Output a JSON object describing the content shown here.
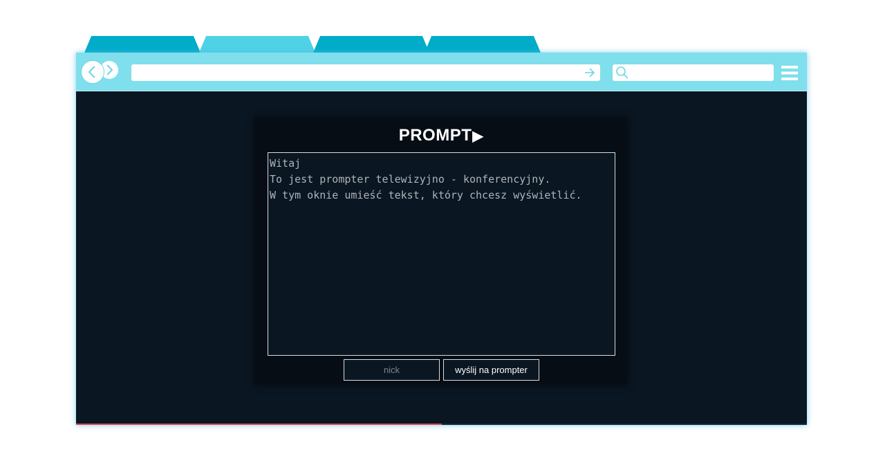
{
  "colors": {
    "tab": "#00acc8",
    "tab_active": "#4fd2e6",
    "toolbar": "#80dfec",
    "viewport_bg": "#0a1622",
    "panel_bg": "#060d15",
    "progress_fill": "#e4494d"
  },
  "browser": {
    "tabs": [
      {
        "active": false
      },
      {
        "active": true
      },
      {
        "active": false
      },
      {
        "active": false
      }
    ],
    "icons": {
      "back": "chevron-left-icon",
      "forward": "chevron-right-icon",
      "go": "arrow-right-icon",
      "search": "search-icon",
      "menu": "hamburger-menu-icon"
    },
    "url_value": "",
    "search_value": "",
    "progress": 0.5
  },
  "app": {
    "logo_text": "PROMPT",
    "logo_arrow": "▶",
    "textarea_value": "Witaj\nTo jest prompter telewizyjno - konferencyjny.\nW tym oknie umieść tekst, który chcesz wyświetlić.",
    "nick_placeholder": "nick",
    "send_label": "wyślij na prompter"
  }
}
